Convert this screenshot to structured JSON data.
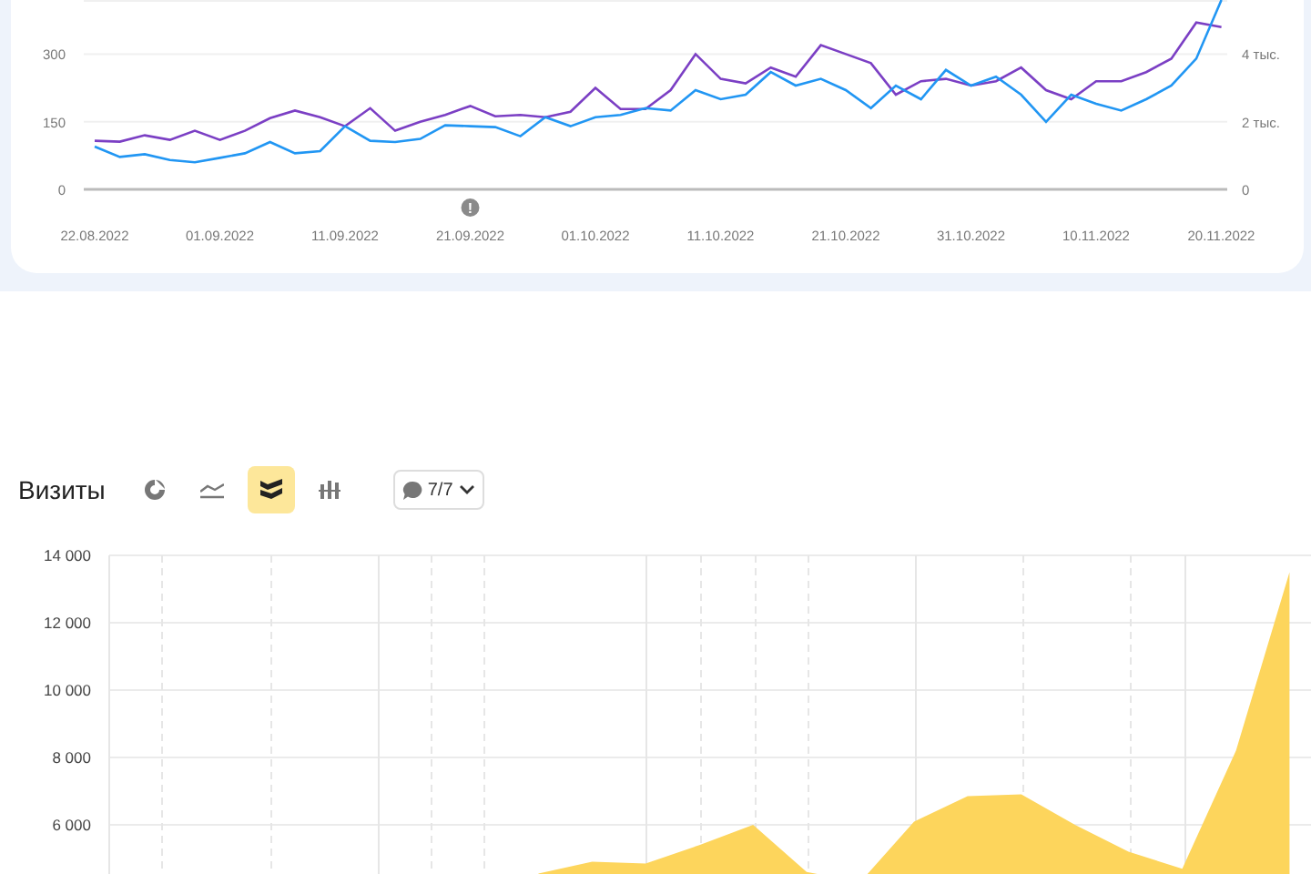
{
  "traffic_panel": {
    "annotation_marker": "!",
    "right_axis_labels": [
      "4 тыс.",
      "2 тыс.",
      "0"
    ],
    "chart_data": {
      "type": "line",
      "categories": [
        "22.08.2022",
        null,
        null,
        null,
        null,
        "01.09.2022",
        null,
        null,
        null,
        null,
        "11.09.2022",
        null,
        null,
        null,
        null,
        "21.09.2022",
        null,
        null,
        null,
        null,
        "01.10.2022",
        null,
        null,
        null,
        null,
        "11.10.2022",
        null,
        null,
        null,
        null,
        "21.10.2022",
        null,
        null,
        null,
        null,
        "31.10.2022",
        null,
        null,
        null,
        null,
        "10.11.2022",
        null,
        null,
        null,
        null,
        "20.11.2022"
      ],
      "ylim": [
        0,
        420
      ],
      "yticks": [
        0,
        150,
        300
      ],
      "series": [
        {
          "color": "#7b3fc4",
          "values": [
            108,
            106,
            120,
            110,
            130,
            110,
            130,
            158,
            175,
            160,
            140,
            180,
            130,
            150,
            165,
            185,
            162,
            165,
            160,
            172,
            225,
            178,
            178,
            220,
            300,
            245,
            235,
            270,
            250,
            320,
            300,
            280,
            210,
            240,
            245,
            230,
            240,
            270,
            220,
            200,
            240,
            240,
            260,
            290,
            370,
            360
          ]
        },
        {
          "color": "#2196f3",
          "values": [
            95,
            72,
            78,
            65,
            60,
            70,
            80,
            105,
            80,
            85,
            140,
            108,
            105,
            112,
            142,
            140,
            138,
            118,
            160,
            140,
            160,
            165,
            180,
            175,
            220,
            200,
            210,
            260,
            230,
            245,
            220,
            180,
            230,
            200,
            265,
            230,
            250,
            210,
            150,
            210,
            190,
            175,
            200,
            230,
            290,
            420
          ]
        }
      ]
    }
  },
  "visits_panel": {
    "view_buttons": [
      {
        "kind": "donut",
        "selected": false
      },
      {
        "kind": "line",
        "selected": false
      },
      {
        "kind": "area",
        "selected": true
      },
      {
        "kind": "bars",
        "selected": false
      }
    ],
    "segments_dropdown": {
      "label": "7/7"
    },
    "chart_data": {
      "type": "area",
      "title": "Визиты",
      "grid": true,
      "categories": [
        null,
        null,
        null,
        null,
        null,
        null,
        null,
        null,
        null,
        null,
        null,
        null,
        null,
        null,
        null,
        null,
        null,
        null,
        null,
        null,
        null,
        null,
        null
      ],
      "ylim": [
        4000,
        14000
      ],
      "yticks": [
        {
          "value": 6000,
          "label": "6 000"
        },
        {
          "value": 8000,
          "label": "8 000"
        },
        {
          "value": 10000,
          "label": "10 000"
        },
        {
          "value": 12000,
          "label": "12 000"
        },
        {
          "value": 14000,
          "label": "14 000"
        }
      ],
      "series": [
        {
          "color": "#fdd55c",
          "values": [
            null,
            null,
            null,
            null,
            null,
            null,
            null,
            null,
            4550,
            4900,
            4850,
            5400,
            6000,
            4600,
            4300,
            6100,
            6850,
            6900,
            6000,
            5200,
            4700,
            8200,
            13500
          ]
        }
      ]
    }
  }
}
